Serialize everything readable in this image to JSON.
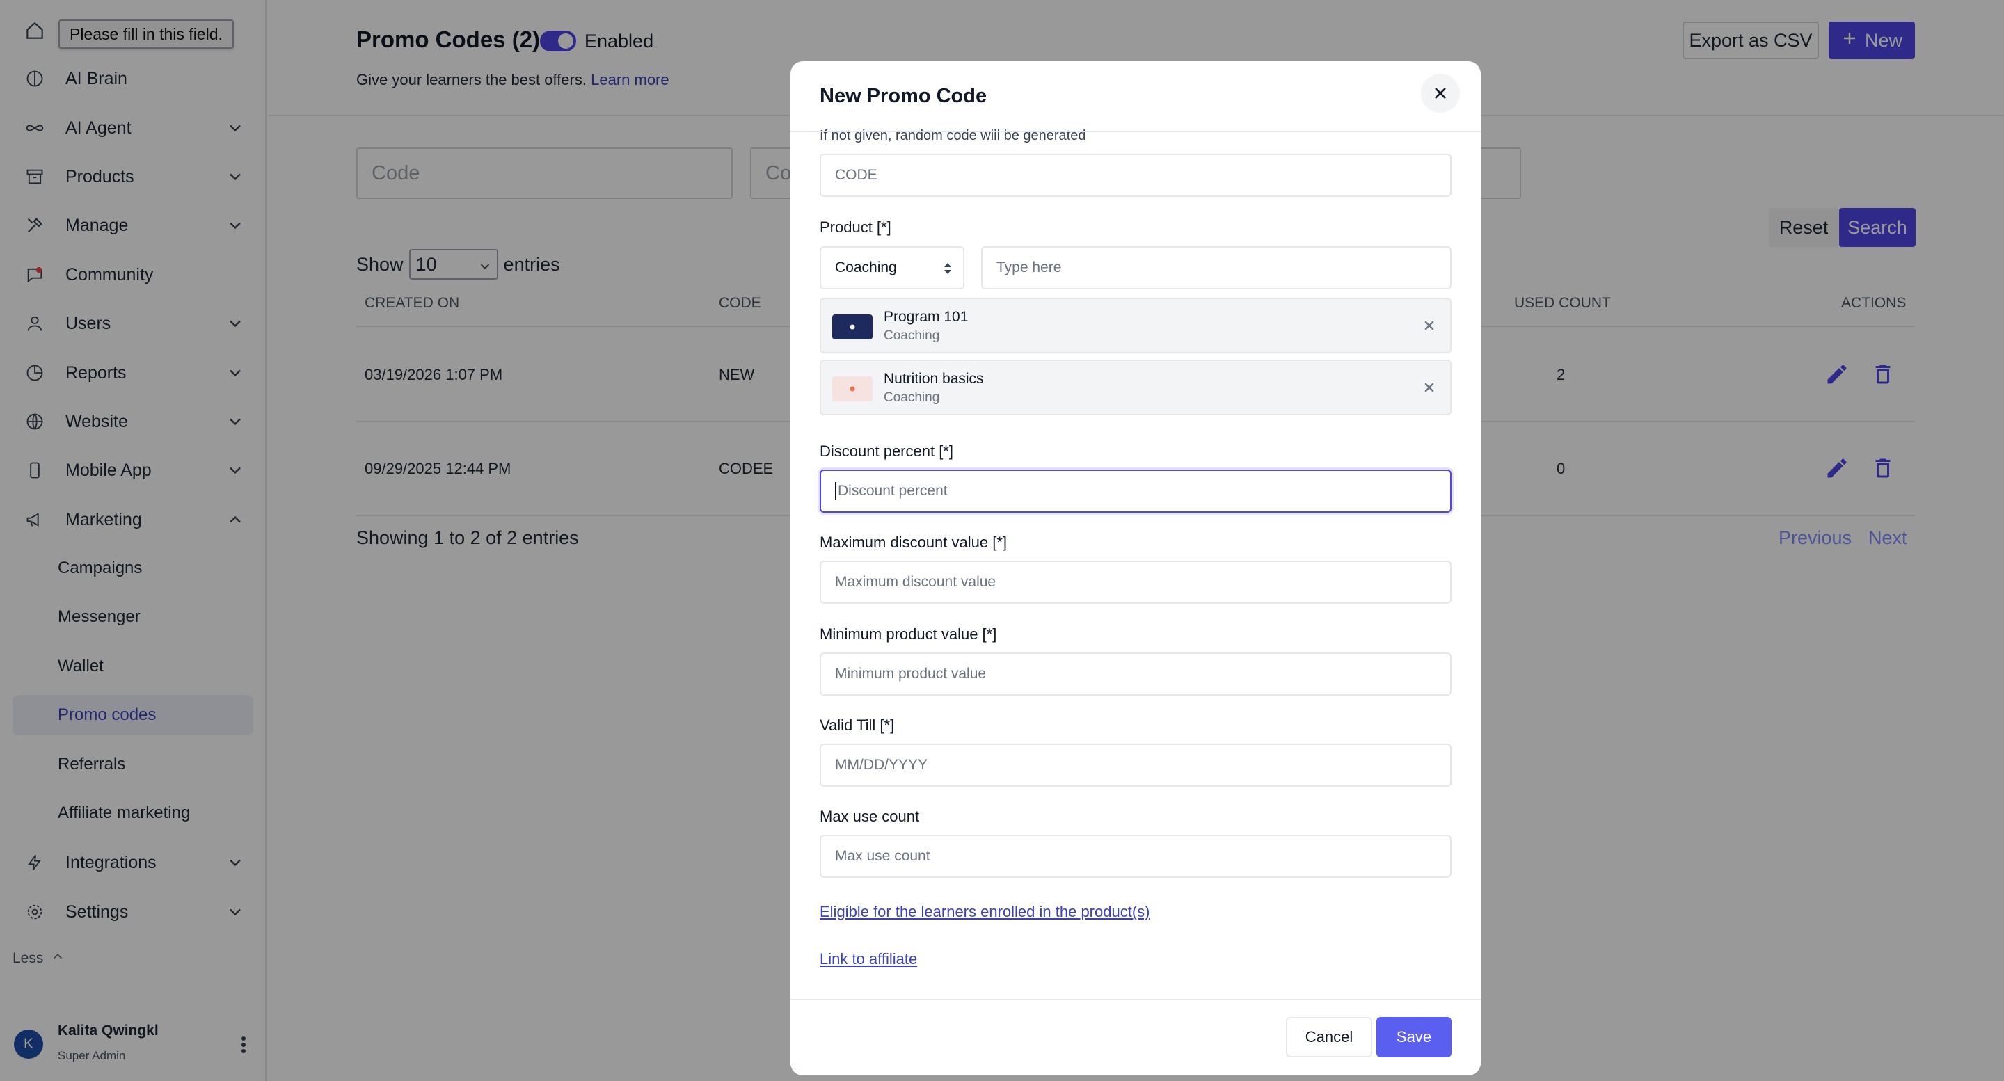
{
  "tooltip": "Please fill in this field.",
  "sidebar": {
    "items": [
      {
        "label": "AI Brain",
        "icon": "brain-icon",
        "has_chevron": false
      },
      {
        "label": "AI Agent",
        "icon": "infinity-icon",
        "has_chevron": true
      },
      {
        "label": "Products",
        "icon": "archive-icon",
        "has_chevron": true
      },
      {
        "label": "Manage",
        "icon": "tools-icon",
        "has_chevron": true
      },
      {
        "label": "Community",
        "icon": "chat-icon",
        "has_chevron": false
      },
      {
        "label": "Users",
        "icon": "user-icon",
        "has_chevron": true
      },
      {
        "label": "Reports",
        "icon": "pie-chart-icon",
        "has_chevron": true
      },
      {
        "label": "Website",
        "icon": "globe-icon",
        "has_chevron": true
      },
      {
        "label": "Mobile App",
        "icon": "mobile-icon",
        "has_chevron": true
      },
      {
        "label": "Marketing",
        "icon": "megaphone-icon",
        "has_chevron": true,
        "expanded": true
      }
    ],
    "marketing_sub": [
      "Campaigns",
      "Messenger",
      "Wallet",
      "Promo codes",
      "Referrals",
      "Affiliate marketing"
    ],
    "active_sub": "Promo codes",
    "bottom_items": [
      {
        "label": "Integrations",
        "icon": "bolt-icon"
      },
      {
        "label": "Settings",
        "icon": "gear-icon"
      }
    ],
    "less": "Less",
    "user": {
      "initial": "K",
      "name": "Kalita Qwingkl",
      "role": "Super Admin"
    }
  },
  "header": {
    "title": "Promo Codes (2)",
    "toggle_label": "Enabled",
    "toggle_on": true,
    "subtitle": "Give your learners the best offers.",
    "learn_more": "Learn more",
    "export": "Export as CSV",
    "new": "New"
  },
  "filters": {
    "code_placeholder": "Code",
    "second_placeholder": "Co",
    "reset": "Reset",
    "search": "Search"
  },
  "table": {
    "show": "Show",
    "entries_value": "10",
    "entries": "entries",
    "columns": [
      "CREATED ON",
      "CODE",
      "USED COUNT",
      "ACTIONS"
    ],
    "rows": [
      {
        "created": "03/19/2026 1:07 PM",
        "code": "NEW",
        "used": "2"
      },
      {
        "created": "09/29/2025 12:44 PM",
        "code": "CODEE",
        "used": "0"
      }
    ],
    "showing": "Showing 1 to 2 of 2 entries",
    "previous": "Previous",
    "next": "Next"
  },
  "modal": {
    "title": "New Promo Code",
    "code_hint": "If not given, random code will be generated",
    "code_placeholder": "CODE",
    "product_label": "Product [*]",
    "product_type": "Coaching",
    "product_search_placeholder": "Type here",
    "products": [
      {
        "name": "Program 101",
        "type": "Coaching",
        "thumb_color": "#1e2a5e",
        "dot_color": "#ffffff"
      },
      {
        "name": "Nutrition basics",
        "type": "Coaching",
        "thumb_color": "#f6e3df",
        "dot_color": "#e76f51"
      }
    ],
    "discount_label": "Discount percent [*]",
    "discount_placeholder": "Discount percent",
    "max_discount_label": "Maximum discount value [*]",
    "max_discount_placeholder": "Maximum discount value",
    "min_product_label": "Minimum product value [*]",
    "min_product_placeholder": "Minimum product value",
    "valid_till_label": "Valid Till [*]",
    "valid_till_placeholder": "MM/DD/YYYY",
    "max_use_label": "Max use count",
    "max_use_placeholder": "Max use count",
    "eligible_link": "Eligible for the learners enrolled in the product(s)",
    "affiliate_link": "Link to affiliate",
    "cancel": "Cancel",
    "save": "Save"
  },
  "colors": {
    "accent": "#4f46e5",
    "active_text": "#3b41b6",
    "overlay": "rgba(0,0,0,0.40)"
  }
}
